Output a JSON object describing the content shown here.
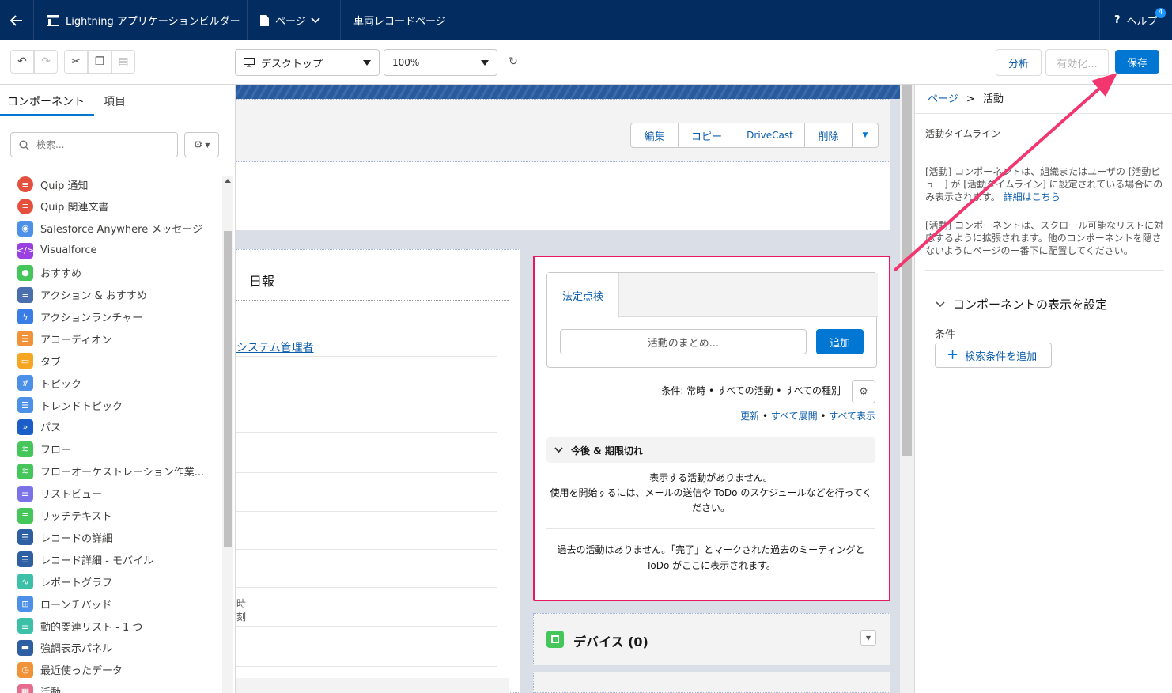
{
  "topbar": {
    "app_title": "Lightning アプリケーションビルダー",
    "page_menu": "ページ",
    "page_name": "車両レコードページ",
    "help": "ヘルプ",
    "help_badge": "4"
  },
  "toolbar": {
    "device_select": "デスクトップ",
    "zoom_select": "100%",
    "analyze_button": "分析",
    "activate_button": "有効化...",
    "save_button": "保存"
  },
  "left_panel": {
    "tabs": [
      "コンポーネント",
      "項目"
    ],
    "search_placeholder": "検索...",
    "components": [
      {
        "label": "Quip 通知",
        "color": "#e4503d"
      },
      {
        "label": "Quip 関連文書",
        "color": "#e4503d"
      },
      {
        "label": "Salesforce Anywhere メッセージ",
        "color": "#4c90e8"
      },
      {
        "label": "Visualforce",
        "color": "#9a40e0"
      },
      {
        "label": "おすすめ",
        "color": "#45c65a"
      },
      {
        "label": "アクション & おすすめ",
        "color": "#4a6fae"
      },
      {
        "label": "アクションランチャー",
        "color": "#3b7de6"
      },
      {
        "label": "アコーディオン",
        "color": "#f09238"
      },
      {
        "label": "タブ",
        "color": "#f5a623"
      },
      {
        "label": "トピック",
        "color": "#4c90e8"
      },
      {
        "label": "トレンドトピック",
        "color": "#4c90e8"
      },
      {
        "label": "パス",
        "color": "#1b5ec7"
      },
      {
        "label": "フロー",
        "color": "#45c65a"
      },
      {
        "label": "フローオーケストレーション作業...",
        "color": "#45c65a"
      },
      {
        "label": "リストビュー",
        "color": "#7b72e8"
      },
      {
        "label": "リッチテキスト",
        "color": "#45c65a"
      },
      {
        "label": "レコードの詳細",
        "color": "#2e5fa3"
      },
      {
        "label": "レコード詳細 - モバイル",
        "color": "#2e5fa3"
      },
      {
        "label": "レポートグラフ",
        "color": "#3cc0a8"
      },
      {
        "label": "ローンチパッド",
        "color": "#4c90e8"
      },
      {
        "label": "動的関連リスト - 1 つ",
        "color": "#3cc0a8"
      },
      {
        "label": "強調表示パネル",
        "color": "#2e5fa3"
      },
      {
        "label": "最近使ったデータ",
        "color": "#f09238"
      },
      {
        "label": "活動",
        "color": "#e66c8d"
      }
    ]
  },
  "canvas": {
    "header_buttons": [
      "編集",
      "コピー",
      "DriveCast",
      "削除"
    ],
    "left_card_title": "日報",
    "owner_link": "システム管理者",
    "time_label": "時刻",
    "activity": {
      "tab_label": "法定点検",
      "summary_placeholder": "活動のまとめ...",
      "add_button": "追加",
      "filter_text": "条件: 常時 • すべての活動 • すべての種別",
      "refresh_link": "更新",
      "expand_all_link": "すべて展開",
      "show_all_link": "すべて表示",
      "dot": "•",
      "section_title": "今後 & 期限切れ",
      "no_activity_line1": "表示する活動がありません。",
      "no_activity_line2": "使用を開始するには、メールの送信や ToDo のスケジュールなどを行ってください。",
      "past_activity": "過去の活動はありません。「完了」とマークされた過去のミーティングと ToDo がここに表示されます。"
    },
    "device_card_title": "デバイス (0)"
  },
  "right_panel": {
    "breadcrumb_page": "ページ",
    "breadcrumb_sep": ">",
    "breadcrumb_current": "活動",
    "component_title": "活動タイムライン",
    "desc1": "[活動] コンポーネントは、組織またはユーザの [活動ビュー] が [活動タイムライン] に設定されている場合にのみ表示されます。",
    "desc1_link": "詳細はこちら",
    "desc2": "[活動] コンポーネントは、スクロール可能なリストに対応するように拡張されます。他のコンポーネントを隠さないようにページの一番下に配置してください。",
    "visibility_title": "コンポーネントの表示を設定",
    "filter_label": "条件",
    "add_filter_button": "検索条件を追加"
  },
  "colors": {
    "nav_bg": "#032d60",
    "brand": "#0176d3",
    "highlight": "#e8195f",
    "arrow": "#f2366f"
  }
}
